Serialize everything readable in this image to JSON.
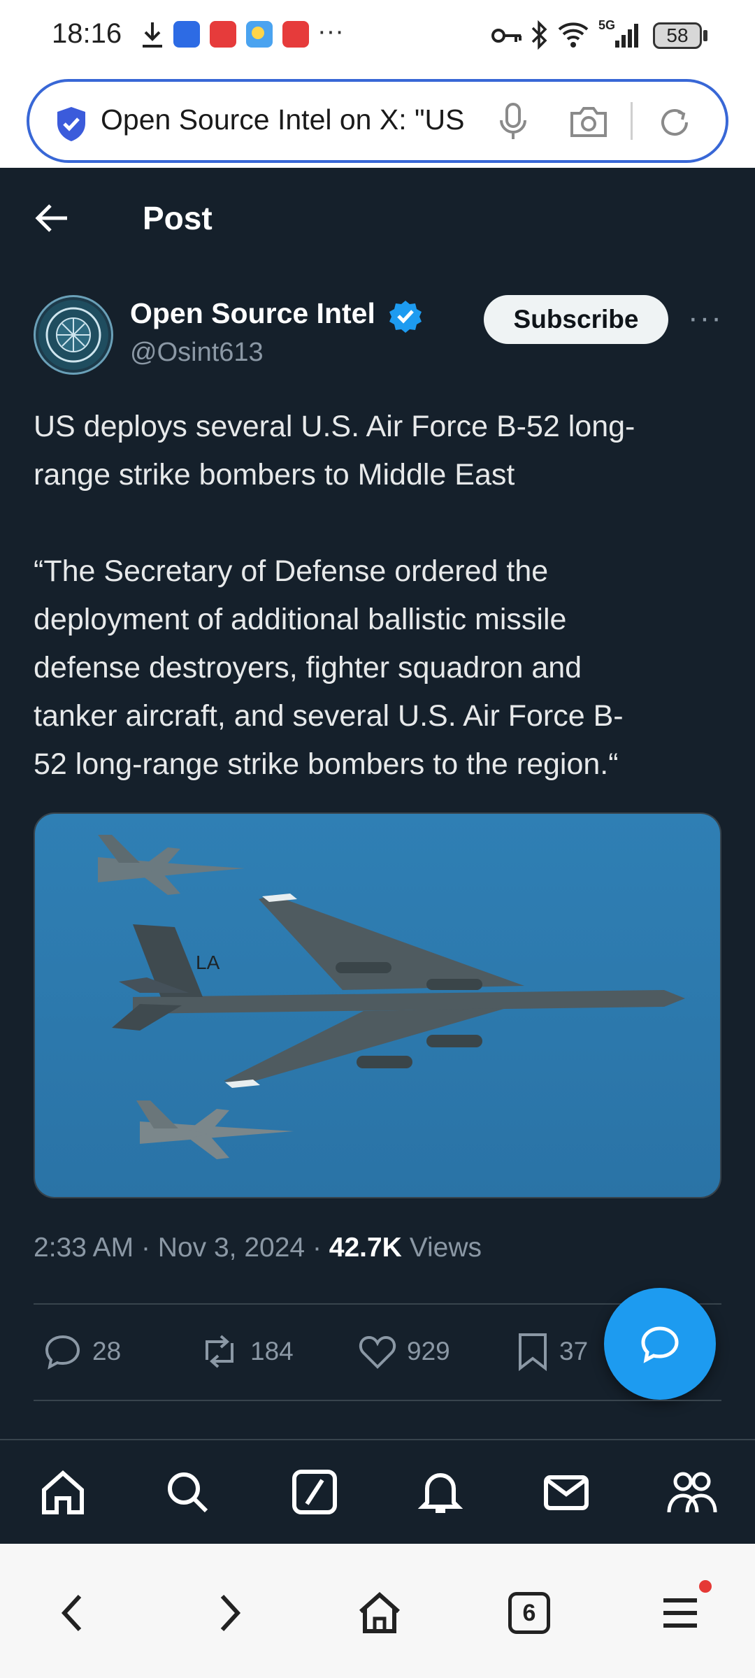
{
  "status_bar": {
    "time": "18:16",
    "overflow": "···",
    "network": "5G",
    "battery": "58",
    "icons": [
      "download-icon",
      "app-blue-icon",
      "app-red-icon",
      "weather-icon",
      "app-red2-icon",
      "key-icon",
      "bluetooth-icon",
      "wifi-icon",
      "signal-icon",
      "battery-icon"
    ]
  },
  "browser": {
    "url_text": "Open Source Intel on X: \"US",
    "icons": [
      "shield-check-icon",
      "microphone-icon",
      "camera-icon",
      "reload-icon"
    ]
  },
  "header": {
    "back_icon": "arrow-left-icon",
    "title": "Post"
  },
  "author": {
    "name": "Open Source Intel",
    "handle": "@Osint613",
    "verified": true,
    "subscribe_label": "Subscribe",
    "more_label": "···"
  },
  "tweet": {
    "paragraph1_line1": "US deploys several U.S. Air Force B-52 long-",
    "paragraph1_line2": "range strike bombers to Middle East",
    "paragraph2_line1": "“The Secretary of Defense ordered the",
    "paragraph2_line2": "deployment of additional ballistic missile",
    "paragraph2_line3": "defense destroyers, fighter squadron and",
    "paragraph2_line4": "tanker aircraft, and several U.S. Air Force B-",
    "paragraph2_line5": "52 long-range strike bombers to the region.“",
    "media_tail_code": "LA"
  },
  "meta": {
    "time": "2:33 AM",
    "sep1": "·",
    "date": "Nov 3, 2024",
    "sep2": "·",
    "views_count": "42.7K",
    "views_label": "Views"
  },
  "actions": {
    "replies": "28",
    "reposts": "184",
    "likes": "929",
    "bookmarks": "37"
  },
  "tabbar": [
    "home-icon",
    "search-icon",
    "grok-icon",
    "notifications-icon",
    "messages-icon",
    "communities-icon"
  ],
  "browser_nav": {
    "tabs_count": "6",
    "icons": [
      "back-arrow-icon",
      "forward-arrow-icon",
      "home-icon",
      "tabs-icon",
      "menu-icon"
    ]
  },
  "colors": {
    "background": "#15202b",
    "accent": "#1d9bf0",
    "text_primary": "#e7e9ea",
    "text_secondary": "#8b98a5",
    "browser_accent": "#3867d6"
  }
}
